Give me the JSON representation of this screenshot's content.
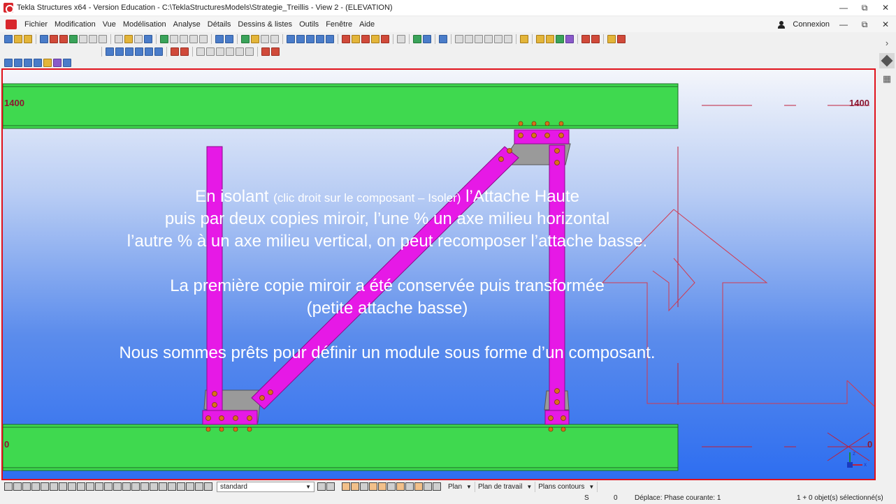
{
  "window": {
    "title": "Tekla Structures x64 - Version Education - C:\\TeklaStructuresModels\\Strategie_Treillis  - View 2 - (ELEVATION)",
    "minimize": "—",
    "maximize": "⧉",
    "close": "✕"
  },
  "menu": {
    "items": [
      "Fichier",
      "Modification",
      "Vue",
      "Modélisation",
      "Analyse",
      "Détails",
      "Dessins & listes",
      "Outils",
      "Fenêtre",
      "Aide"
    ],
    "connexion": "Connexion"
  },
  "viewport": {
    "grid_labels": {
      "top_left": "1400",
      "top_right": "1400",
      "bottom_left": "0",
      "bottom_right": "0"
    },
    "text": {
      "line1_a": "En isolant ",
      "line1_small": "(clic droit sur le composant – Isoler)",
      "line1_b": " l’Attache Haute",
      "line2": "puis par deux copies miroir, l’une % un axe milieu horizontal",
      "line3": "l’autre  % à un axe milieu vertical, on peut recomposer l’attache basse.",
      "line4": "La première copie miroir a été conservée puis transformée",
      "line5": "(petite attache basse)",
      "line6": "Nous sommes prêts pour définir un module sous forme d’un composant."
    }
  },
  "bottom_toolbar": {
    "filter_value": "standard",
    "plan": "Plan",
    "plan_de_travail": "Plan de travail",
    "plans_contours": "Plans contours"
  },
  "status": {
    "s": "S",
    "zero": "0",
    "message": "Déplace: Phase courante: 1",
    "selection": "1 + 0 objet(s) sélectionné(s)"
  },
  "colors": {
    "beam_green": "#3fd94f",
    "member_magenta": "#e619e6",
    "plate_gray": "#9a9a9a",
    "bolt_orange": "#d9701a",
    "frame_red": "#e0121c",
    "grid_red": "#c0203a"
  }
}
